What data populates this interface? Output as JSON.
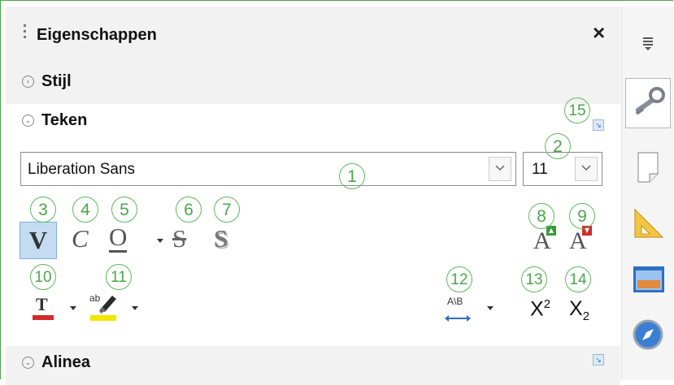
{
  "panel": {
    "title": "Eigenschappen",
    "close_glyph": "×"
  },
  "sections": {
    "stijl": {
      "label": "Stijl"
    },
    "teken": {
      "label": "Teken"
    },
    "alinea": {
      "label": "Alinea"
    }
  },
  "character": {
    "font_name": "Liberation Sans",
    "font_size": "11",
    "bold_glyph": "V",
    "italic_glyph": "C",
    "underline_glyph": "O",
    "strike_glyph": "S",
    "shadow_glyph": "S",
    "grow_glyph": "A",
    "shrink_glyph": "A",
    "highlight_text": "ab",
    "spacing_text": "A\\B",
    "superscript_base": "X",
    "superscript_exp": "2",
    "subscript_base": "X",
    "subscript_exp": "2"
  },
  "callouts": [
    "1",
    "2",
    "3",
    "4",
    "5",
    "6",
    "7",
    "8",
    "9",
    "10",
    "11",
    "12",
    "13",
    "14",
    "15"
  ],
  "icons": {
    "sidebar_menu": "menu-icon",
    "properties": "wrench-icon",
    "page": "page-icon",
    "styles": "styles-icon",
    "gallery": "gallery-icon",
    "navigator": "navigator-icon"
  },
  "colors": {
    "callout": "#4aa64a",
    "font_color": "#d42a2a",
    "highlight": "#f5e600",
    "accent_blue": "#2e6fc4"
  }
}
